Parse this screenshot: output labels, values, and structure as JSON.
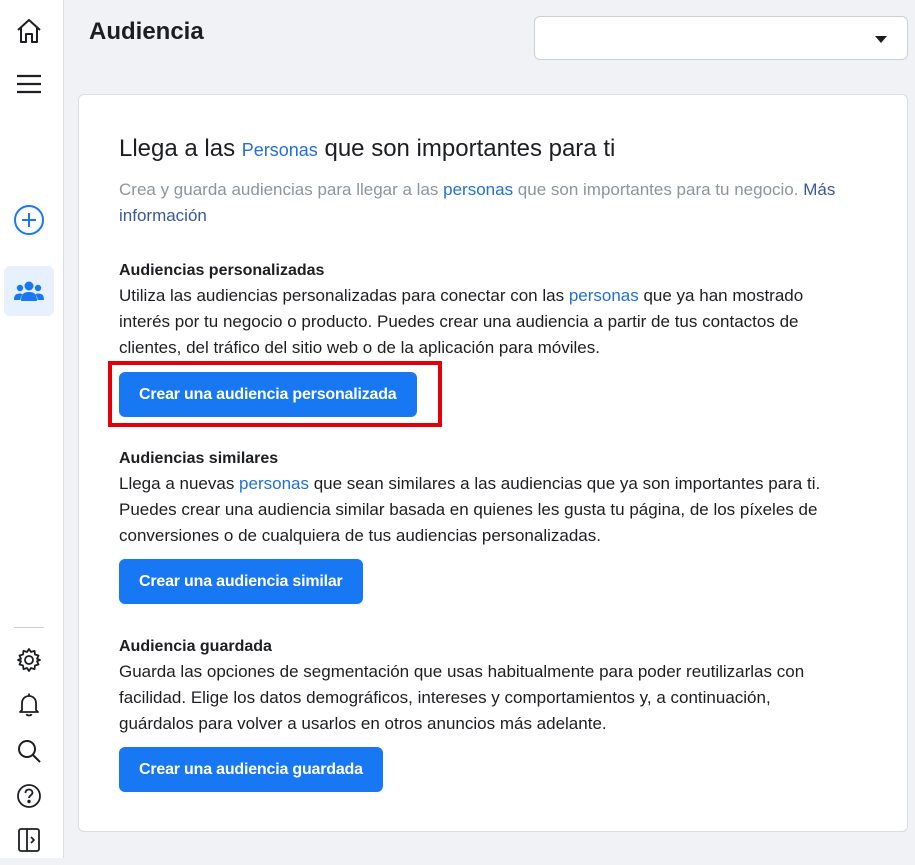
{
  "header": {
    "title": "Audiencia"
  },
  "account_select": {
    "value": ""
  },
  "sidebar": {
    "icons": [
      "home-icon",
      "menu-icon",
      "create-icon",
      "audience-icon",
      "settings-icon",
      "notifications-icon",
      "search-icon",
      "help-icon",
      "collapse-panel-icon"
    ],
    "accent": "#1877f2"
  },
  "main": {
    "headline": {
      "pre": "Llega a las ",
      "link": "Personas",
      "post": " que son importantes para ti"
    },
    "intro": {
      "pre": "Crea y guarda audiencias para llegar a las ",
      "link": "personas",
      "post": " que son importantes para tu negocio. ",
      "more": "Más información"
    },
    "sections": [
      {
        "title": "Audiencias personalizadas",
        "desc_pre": "Utiliza las audiencias personalizadas para conectar con las ",
        "desc_link": "personas",
        "desc_post": " que ya han mostrado interés por tu negocio o producto. Puedes crear una audiencia a partir de tus contactos de clientes, del tráfico del sitio web o de la aplicación para móviles.",
        "button": "Crear una audiencia personalizada"
      },
      {
        "title": "Audiencias similares",
        "desc_pre": "Llega a nuevas ",
        "desc_link": "personas",
        "desc_post": " que sean similares a las audiencias que ya son importantes para ti. Puedes crear una audiencia similar basada en quienes les gusta tu página, de los píxeles de conversiones o de cualquiera de tus audiencias personalizadas.",
        "button": "Crear una audiencia similar"
      },
      {
        "title": "Audiencia guardada",
        "desc": "Guarda las opciones de segmentación que usas habitualmente para poder reutilizarlas con facilidad. Elige los datos demográficos, intereses y comportamientos y, a continuación, guárdalos para volver a usarlos en otros anuncios más adelante.",
        "button": "Crear una audiencia guardada"
      }
    ]
  },
  "colors": {
    "button": "#1877f2",
    "link": "#216fdb",
    "highlight": "#e4000b"
  }
}
